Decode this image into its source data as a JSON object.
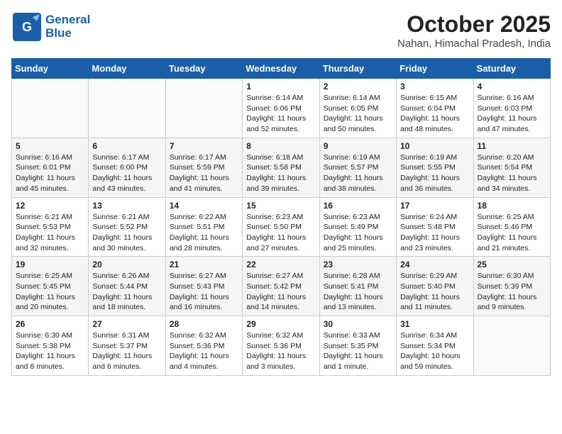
{
  "header": {
    "logo_line1": "General",
    "logo_line2": "Blue",
    "month": "October 2025",
    "location": "Nahan, Himachal Pradesh, India"
  },
  "days_of_week": [
    "Sunday",
    "Monday",
    "Tuesday",
    "Wednesday",
    "Thursday",
    "Friday",
    "Saturday"
  ],
  "weeks": [
    [
      {
        "day": "",
        "content": ""
      },
      {
        "day": "",
        "content": ""
      },
      {
        "day": "",
        "content": ""
      },
      {
        "day": "1",
        "content": "Sunrise: 6:14 AM\nSunset: 6:06 PM\nDaylight: 11 hours\nand 52 minutes."
      },
      {
        "day": "2",
        "content": "Sunrise: 6:14 AM\nSunset: 6:05 PM\nDaylight: 11 hours\nand 50 minutes."
      },
      {
        "day": "3",
        "content": "Sunrise: 6:15 AM\nSunset: 6:04 PM\nDaylight: 11 hours\nand 48 minutes."
      },
      {
        "day": "4",
        "content": "Sunrise: 6:16 AM\nSunset: 6:03 PM\nDaylight: 11 hours\nand 47 minutes."
      }
    ],
    [
      {
        "day": "5",
        "content": "Sunrise: 6:16 AM\nSunset: 6:01 PM\nDaylight: 11 hours\nand 45 minutes."
      },
      {
        "day": "6",
        "content": "Sunrise: 6:17 AM\nSunset: 6:00 PM\nDaylight: 11 hours\nand 43 minutes."
      },
      {
        "day": "7",
        "content": "Sunrise: 6:17 AM\nSunset: 5:59 PM\nDaylight: 11 hours\nand 41 minutes."
      },
      {
        "day": "8",
        "content": "Sunrise: 6:18 AM\nSunset: 5:58 PM\nDaylight: 11 hours\nand 39 minutes."
      },
      {
        "day": "9",
        "content": "Sunrise: 6:19 AM\nSunset: 5:57 PM\nDaylight: 11 hours\nand 38 minutes."
      },
      {
        "day": "10",
        "content": "Sunrise: 6:19 AM\nSunset: 5:55 PM\nDaylight: 11 hours\nand 36 minutes."
      },
      {
        "day": "11",
        "content": "Sunrise: 6:20 AM\nSunset: 5:54 PM\nDaylight: 11 hours\nand 34 minutes."
      }
    ],
    [
      {
        "day": "12",
        "content": "Sunrise: 6:21 AM\nSunset: 5:53 PM\nDaylight: 11 hours\nand 32 minutes."
      },
      {
        "day": "13",
        "content": "Sunrise: 6:21 AM\nSunset: 5:52 PM\nDaylight: 11 hours\nand 30 minutes."
      },
      {
        "day": "14",
        "content": "Sunrise: 6:22 AM\nSunset: 5:51 PM\nDaylight: 11 hours\nand 28 minutes."
      },
      {
        "day": "15",
        "content": "Sunrise: 6:23 AM\nSunset: 5:50 PM\nDaylight: 11 hours\nand 27 minutes."
      },
      {
        "day": "16",
        "content": "Sunrise: 6:23 AM\nSunset: 5:49 PM\nDaylight: 11 hours\nand 25 minutes."
      },
      {
        "day": "17",
        "content": "Sunrise: 6:24 AM\nSunset: 5:48 PM\nDaylight: 11 hours\nand 23 minutes."
      },
      {
        "day": "18",
        "content": "Sunrise: 6:25 AM\nSunset: 5:46 PM\nDaylight: 11 hours\nand 21 minutes."
      }
    ],
    [
      {
        "day": "19",
        "content": "Sunrise: 6:25 AM\nSunset: 5:45 PM\nDaylight: 11 hours\nand 20 minutes."
      },
      {
        "day": "20",
        "content": "Sunrise: 6:26 AM\nSunset: 5:44 PM\nDaylight: 11 hours\nand 18 minutes."
      },
      {
        "day": "21",
        "content": "Sunrise: 6:27 AM\nSunset: 5:43 PM\nDaylight: 11 hours\nand 16 minutes."
      },
      {
        "day": "22",
        "content": "Sunrise: 6:27 AM\nSunset: 5:42 PM\nDaylight: 11 hours\nand 14 minutes."
      },
      {
        "day": "23",
        "content": "Sunrise: 6:28 AM\nSunset: 5:41 PM\nDaylight: 11 hours\nand 13 minutes."
      },
      {
        "day": "24",
        "content": "Sunrise: 6:29 AM\nSunset: 5:40 PM\nDaylight: 11 hours\nand 11 minutes."
      },
      {
        "day": "25",
        "content": "Sunrise: 6:30 AM\nSunset: 5:39 PM\nDaylight: 11 hours\nand 9 minutes."
      }
    ],
    [
      {
        "day": "26",
        "content": "Sunrise: 6:30 AM\nSunset: 5:38 PM\nDaylight: 11 hours\nand 8 minutes."
      },
      {
        "day": "27",
        "content": "Sunrise: 6:31 AM\nSunset: 5:37 PM\nDaylight: 11 hours\nand 6 minutes."
      },
      {
        "day": "28",
        "content": "Sunrise: 6:32 AM\nSunset: 5:36 PM\nDaylight: 11 hours\nand 4 minutes."
      },
      {
        "day": "29",
        "content": "Sunrise: 6:32 AM\nSunset: 5:36 PM\nDaylight: 11 hours\nand 3 minutes."
      },
      {
        "day": "30",
        "content": "Sunrise: 6:33 AM\nSunset: 5:35 PM\nDaylight: 11 hours\nand 1 minute."
      },
      {
        "day": "31",
        "content": "Sunrise: 6:34 AM\nSunset: 5:34 PM\nDaylight: 10 hours\nand 59 minutes."
      },
      {
        "day": "",
        "content": ""
      }
    ]
  ]
}
